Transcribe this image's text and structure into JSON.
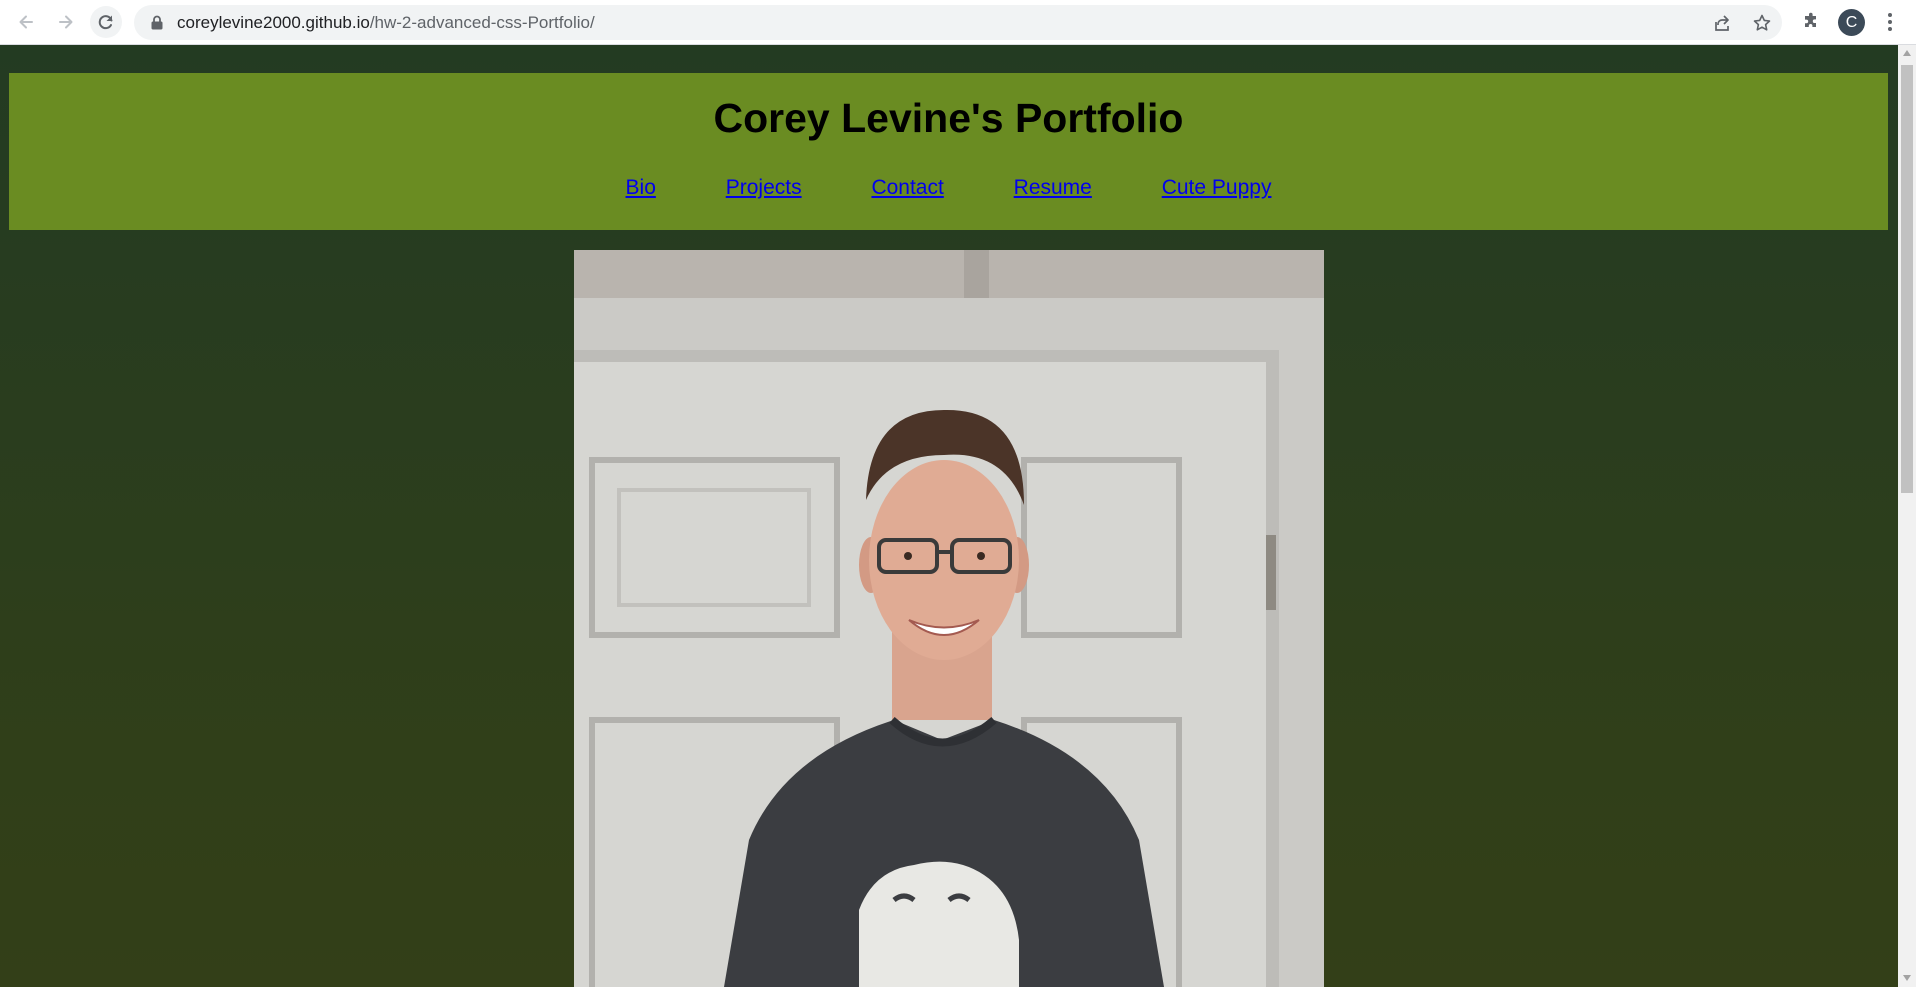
{
  "browser": {
    "url_host": "coreylevine2000.github.io",
    "url_path": "/hw-2-advanced-css-Portfolio/",
    "profile_initial": "C",
    "icons": [
      "back-arrow-icon",
      "forward-arrow-icon",
      "reload-icon",
      "lock-icon",
      "share-icon",
      "star-icon",
      "extensions-icon",
      "kebab-menu-icon"
    ]
  },
  "page": {
    "title": "Corey Levine's Portfolio",
    "nav": [
      {
        "label": "Bio"
      },
      {
        "label": "Projects"
      },
      {
        "label": "Contact"
      },
      {
        "label": "Resume"
      },
      {
        "label": "Cute Puppy"
      }
    ],
    "colors": {
      "header_band": "#6a8c22",
      "background_top": "#233b22",
      "background_bottom": "#333f18",
      "link": "#0000ee"
    }
  }
}
